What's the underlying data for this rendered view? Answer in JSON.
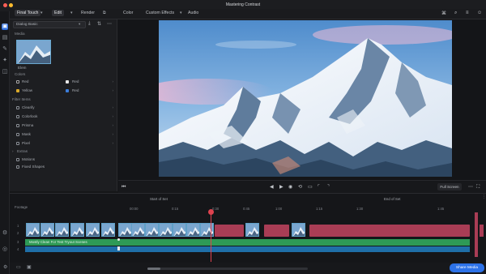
{
  "window": {
    "title": "Mastering Contrast"
  },
  "menu": {
    "items": [
      "Final Touch",
      "Edit",
      "Render",
      "Color",
      "Custom Effects",
      "Audio"
    ]
  },
  "left_panel": {
    "search_value": "Dialog Basic",
    "section_media": "Media",
    "media_caption": "Elem",
    "section_colors": "Colors",
    "colors": [
      {
        "label": "Red",
        "color": "#1a1a1a"
      },
      {
        "label": "Red",
        "color": "#e8e8e8"
      },
      {
        "label": "Yellow",
        "color": "#d9a92a"
      },
      {
        "label": "Red",
        "color": "#3b7ddb"
      }
    ],
    "section_filters": "Filter Items",
    "filters": [
      "Clearify",
      "Colorlook",
      "Prisma",
      "Mask",
      "Pixel"
    ],
    "section_extras": "Extras",
    "extras": [
      "Motions",
      "Fixed Shapes"
    ]
  },
  "timeline": {
    "track_label": "Footage",
    "ruler": [
      "00:00",
      "0:15",
      "0:30",
      "0:45",
      "1:00",
      "1:15",
      "1:30",
      "1:45"
    ],
    "marker_left": "Start of Set",
    "marker_right": "End of Set",
    "clip_title": "Mostly Clean For Test Tryout Scenes",
    "track_numbers": [
      "1",
      "2",
      "3",
      "4"
    ]
  },
  "controls": {
    "fit_label": "Full Screen"
  },
  "footer": {
    "export_label": "Share Media"
  },
  "colors": {
    "accent": "#2d72e8",
    "playhead": "#e0424f",
    "clip_pink": "#a93d55",
    "audio_green": "#2e9a56",
    "audio_blue": "#1f6fa8"
  }
}
